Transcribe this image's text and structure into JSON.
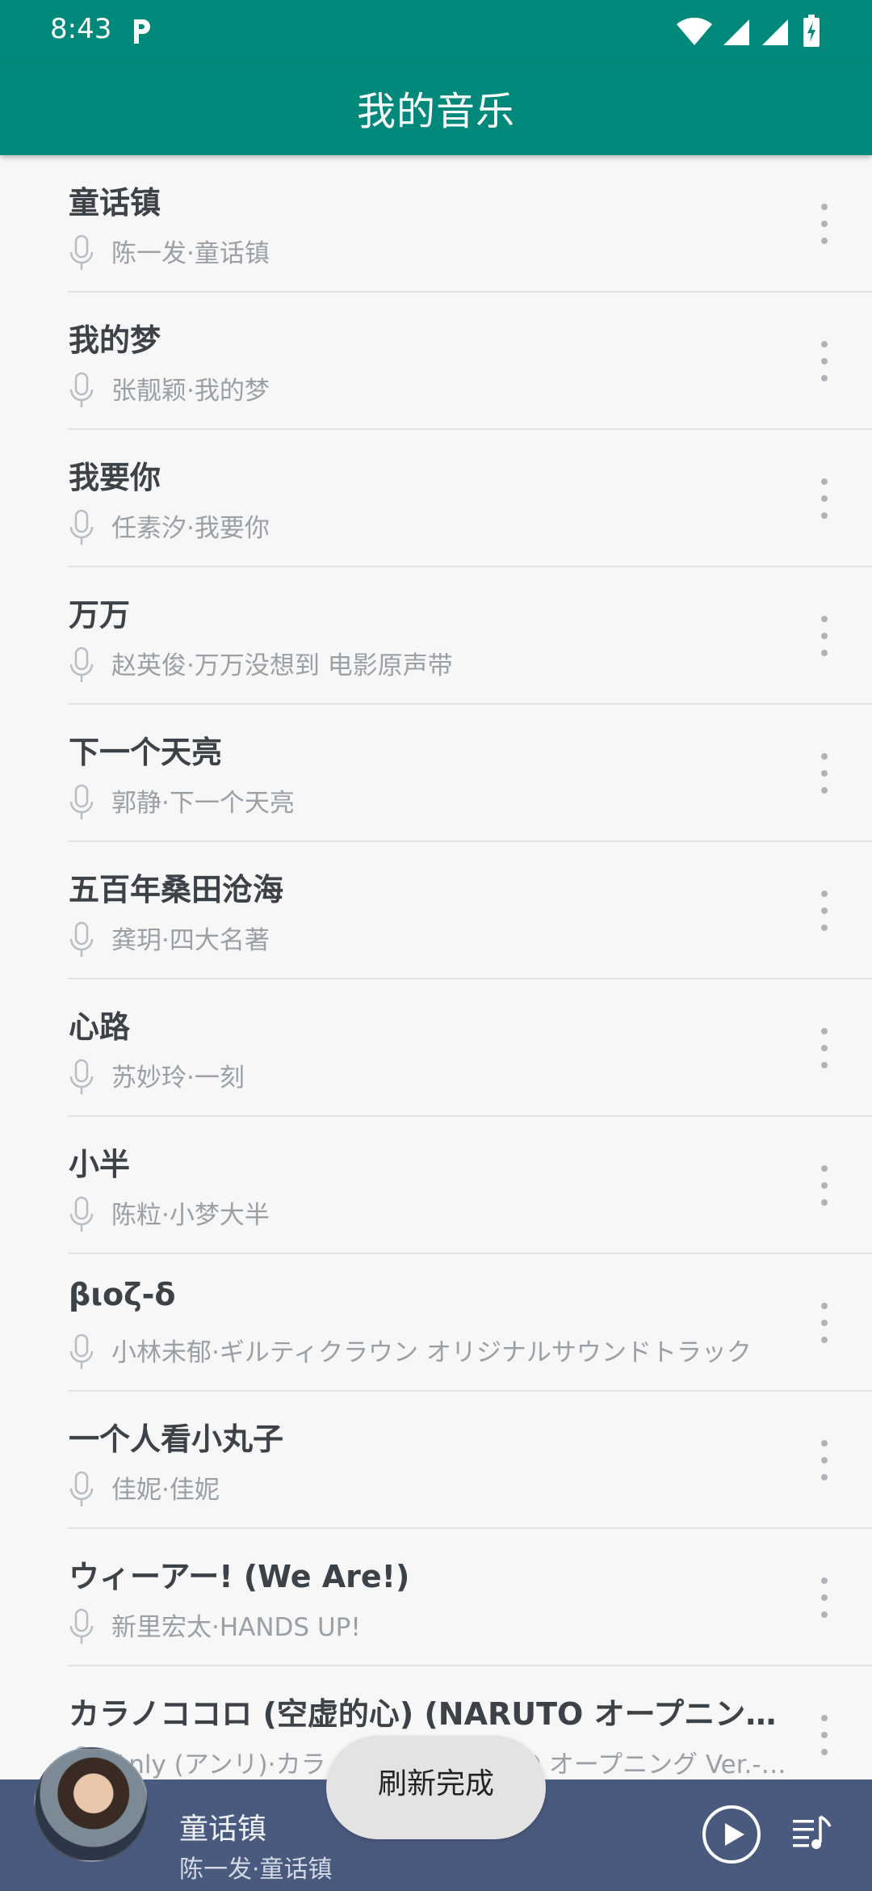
{
  "status_bar": {
    "time": "8:43",
    "icons": [
      "parking-app-icon",
      "wifi-icon",
      "signal-icon",
      "signal-icon",
      "battery-charging-icon"
    ]
  },
  "app_bar": {
    "title": "我的音乐"
  },
  "songs": [
    {
      "title": "童话镇",
      "subtitle": "陈一发·童话镇"
    },
    {
      "title": "我的梦",
      "subtitle": "张靓颖·我的梦"
    },
    {
      "title": "我要你",
      "subtitle": "任素汐·我要你"
    },
    {
      "title": "万万",
      "subtitle": "赵英俊·万万没想到 电影原声带"
    },
    {
      "title": "下一个天亮",
      "subtitle": "郭静·下一个天亮"
    },
    {
      "title": "五百年桑田沧海",
      "subtitle": "龚玥·四大名著"
    },
    {
      "title": "心路",
      "subtitle": "苏妙玲·一刻"
    },
    {
      "title": "小半",
      "subtitle": "陈粒·小梦大半"
    },
    {
      "title": "βιοζ-δ",
      "subtitle": "小林未郁·ギルティクラウン オリジナルサウンドトラック"
    },
    {
      "title": "一个人看小丸子",
      "subtitle": "佳妮·佳妮"
    },
    {
      "title": "ウィーアー! (We Are!)",
      "subtitle": "新里宏太·HANDS UP!"
    },
    {
      "title": "カラノココロ (空虚的心) (NARUTO オープニング Ver.)",
      "subtitle": "Anly (アンリ)·カラノココロ-NARUTO オープニング Ver.- (Single)"
    }
  ],
  "player": {
    "title": "童话镇",
    "subtitle": "陈一发·童话镇"
  },
  "toast": {
    "text": "刷新完成"
  },
  "colors": {
    "primary": "#00897b",
    "player_bar": "#4a5a7e",
    "background": "#f7f7f7"
  }
}
